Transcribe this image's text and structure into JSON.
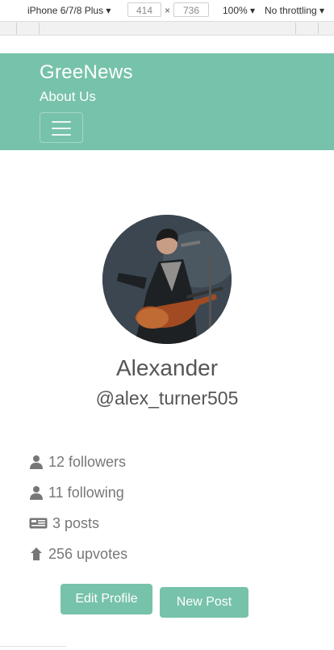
{
  "devtools": {
    "device": "iPhone 6/7/8 Plus",
    "width": "414",
    "height": "736",
    "zoom": "100%",
    "throttling": "No throttling"
  },
  "navbar": {
    "brand": "GreeNews",
    "about": "About Us"
  },
  "profile": {
    "name": "Alexander",
    "handle": "@alex_turner505"
  },
  "stats": {
    "followers": "12 followers",
    "following": "11 following",
    "posts": "3 posts",
    "upvotes": "256 upvotes"
  },
  "actions": {
    "edit_profile": "Edit Profile",
    "new_post": "New Post"
  },
  "colors": {
    "accent": "#77c2aa",
    "text": "#555555",
    "muted": "#777777"
  }
}
